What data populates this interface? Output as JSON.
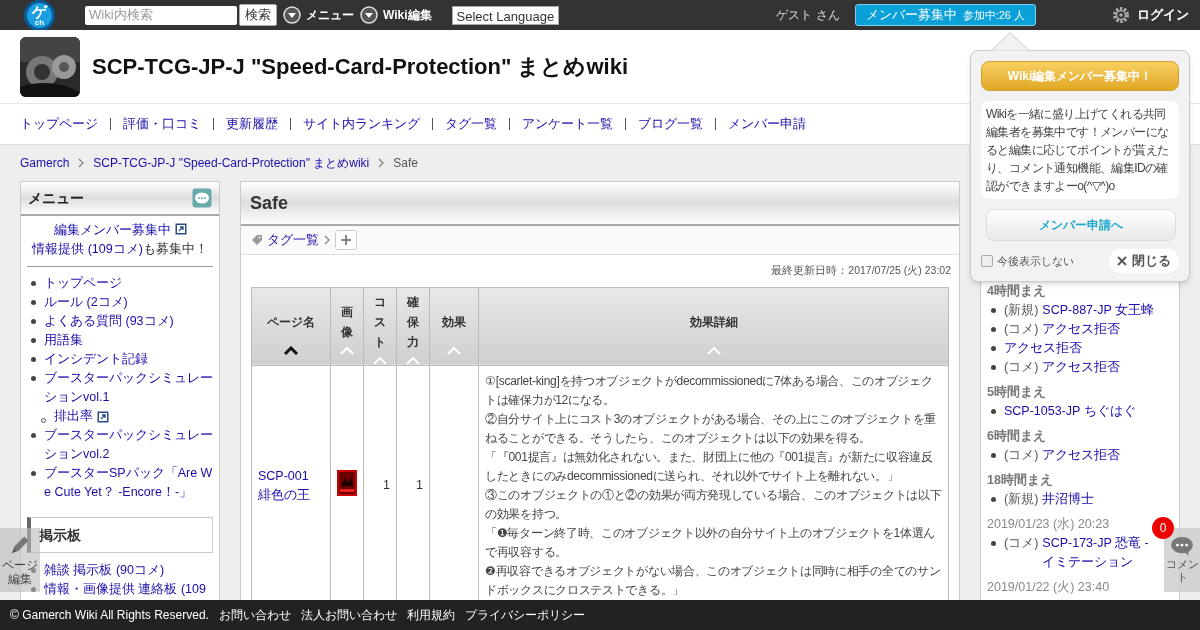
{
  "topbar": {
    "logo": {
      "main": "ゲ",
      "sub": "ch"
    },
    "search": {
      "placeholder": "Wiki内検索"
    },
    "search_button": "検索",
    "menus": [
      "メニュー",
      "Wiki編集"
    ],
    "language": "Select Language",
    "guest": "ゲスト さん",
    "recruit": {
      "label": "メンバー募集中",
      "count": "参加中:26 人"
    },
    "login": "ログイン"
  },
  "header": {
    "title": "SCP-TCG-JP-J \"Speed-Card-Protection\" まとめwiki"
  },
  "nav": [
    "トップページ",
    "評価・口コミ",
    "更新履歴",
    "サイト内ランキング",
    "タグ一覧",
    "アンケート一覧",
    "ブログ一覧",
    "メンバー申請"
  ],
  "breadcrumb": [
    {
      "label": "Gamerch",
      "link": true
    },
    {
      "label": "SCP-TCG-JP-J \"Speed-Card-Protection\" まとめwiki",
      "link": true
    },
    {
      "label": "Safe",
      "link": false
    }
  ],
  "sidebar": {
    "title": "メニュー",
    "recruit_link": "編集メンバー募集中",
    "info_link": "情報提供 (109コメ)",
    "info_suffix": "も募集中！",
    "items": [
      {
        "label": "トップページ"
      },
      {
        "label": "ルール (2コメ)"
      },
      {
        "label": "よくある質問 (93コメ)"
      },
      {
        "label": "用語集"
      },
      {
        "label": "インシデント記録"
      },
      {
        "label": "ブースターパックシミュレーションvol.1",
        "children": [
          {
            "label": "排出率",
            "external": true
          }
        ]
      },
      {
        "label": "ブースターパックシミュレーションvol.2"
      },
      {
        "label": "ブースターSPパック「Are We Cute Yet？ -Encore！-」"
      }
    ],
    "board_title": "掲示板",
    "board_items": [
      "雑談 掲示板 (90コメ)",
      "情報・画像提供 連絡板 (109"
    ]
  },
  "main": {
    "title": "Safe",
    "tags_link": "タグ一覧",
    "updated": "最終更新日時：2017/07/25 (火) 23:02",
    "table": {
      "columns": [
        {
          "label": "ページ名",
          "vertical": false,
          "sorted": true
        },
        {
          "label": "画像",
          "vertical": true,
          "sorted": false
        },
        {
          "label": "コスト",
          "vertical": true,
          "sorted": false
        },
        {
          "label": "確保力",
          "vertical": true,
          "sorted": false
        },
        {
          "label": "効果",
          "vertical": false,
          "sorted": false
        },
        {
          "label": "効果詳細",
          "vertical": false,
          "sorted": false
        }
      ],
      "rows": [
        {
          "name": "SCP-001 緋色の王",
          "cost": "1",
          "secure": "1",
          "effect_lines": [
            "①[scarlet-king]を持つオブジェクトがdecommissionedに7体ある場合、このオブジェクトは確保力が12になる。",
            "②自分サイト上にコスト3のオブジェクトがある場合、その上にこのオブジェクトを重ねることができる。そうしたら、このオブジェクトは以下の効果を得る。",
            "「『001提言』は無効化されない。また、財団上に他の『001提言』が新たに収容違反したときにのみdecommissionedに送られ、それ以外でサイト上を離れない。」",
            "③このオブジェクトの①と②の効果が両方発現している場合、このオブジェクトは以下の効果を持つ。",
            "「❶毎ターン終了時、このオブジェクト以外の自分サイト上のオブジェクトを1体選んで再収容する。",
            "❷再収容できるオブジェクトがない場合、このオブジェクトは同時に相手の全てのサンドボックスにクロステストできる。」"
          ]
        }
      ]
    }
  },
  "updates": [
    {
      "when": "4時間まえ",
      "kind": "relative",
      "items": [
        {
          "type": "(新規)",
          "page": "SCP-887-JP 女王蜂"
        },
        {
          "type": "(コメ)",
          "page": "アクセス拒否"
        },
        {
          "page": "アクセス拒否"
        },
        {
          "type": "(コメ)",
          "page": "アクセス拒否"
        }
      ]
    },
    {
      "when": "5時間まえ",
      "kind": "relative",
      "items": [
        {
          "page": "SCP-1053-JP ちぐはぐ"
        }
      ]
    },
    {
      "when": "6時間まえ",
      "kind": "relative",
      "items": [
        {
          "type": "(コメ)",
          "page": "アクセス拒否"
        }
      ]
    },
    {
      "when": "18時間まえ",
      "kind": "relative",
      "items": [
        {
          "type": "(新規)",
          "page": "井沼博士"
        }
      ]
    },
    {
      "when": "2019/01/23 (水) 20:23",
      "kind": "date",
      "items": [
        {
          "type": "(コメ)",
          "page": "SCP-173-JP 恐竜 - イミテーション"
        }
      ]
    },
    {
      "when": "2019/01/22 (火) 23:40",
      "kind": "date"
    }
  ],
  "popup": {
    "title": "Wiki編集メンバー募集中！",
    "body": "Wikiを一緒に盛り上げてくれる共同編集者を募集中です！メンバーになると編集に応じてポイントが貰えたり、コメント通知機能、編集IDの確認ができますよーo(^▽^)o",
    "apply": "メンバー申請へ",
    "dont_show": {
      "label": "今後表示しない",
      "checked": false
    },
    "close": "閉じる"
  },
  "page_edit": "ページ編集",
  "comment": {
    "label": "コメント",
    "count": "0"
  },
  "footer": [
    "© Gamerch Wiki All Rights Reserved.",
    "お問い合わせ",
    "法人お問い合わせ",
    "利用規約",
    "プライバシーポリシー"
  ]
}
